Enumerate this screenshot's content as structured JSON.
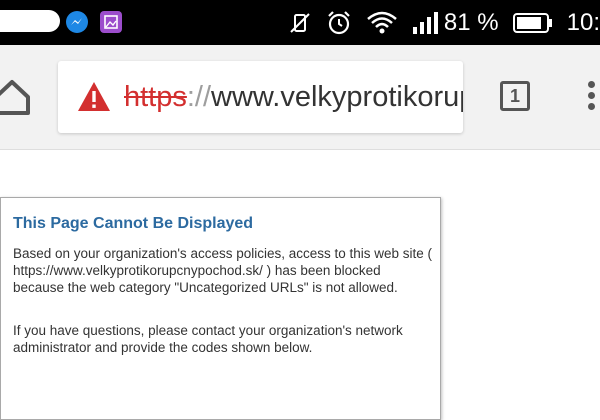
{
  "status_bar": {
    "battery_percent": "81 %",
    "time": "10:",
    "icons": [
      "messenger-icon",
      "gallery-icon",
      "vibrate-off-icon",
      "alarm-icon",
      "wifi-icon",
      "signal-icon",
      "battery-icon"
    ]
  },
  "toolbar": {
    "url_scheme": "https",
    "url_separator": "://",
    "url_host": "www.velkyprotikorupc",
    "tab_count": "1"
  },
  "error": {
    "title": "This Page Cannot Be Displayed",
    "paragraph_1": "Based on your organization's access policies, access to this web site ( https://www.velkyprotikorupcnypochod.sk/ ) has been blocked because the web category \"Uncategorized URLs\" is not allowed.",
    "paragraph_2": "If you have questions, please contact your organization's network administrator and provide the codes shown below."
  },
  "colors": {
    "status_bar_bg": "#000000",
    "toolbar_bg": "#f2f2f2",
    "warning_red": "#d32f2f",
    "title_blue": "#2c6aa0"
  }
}
